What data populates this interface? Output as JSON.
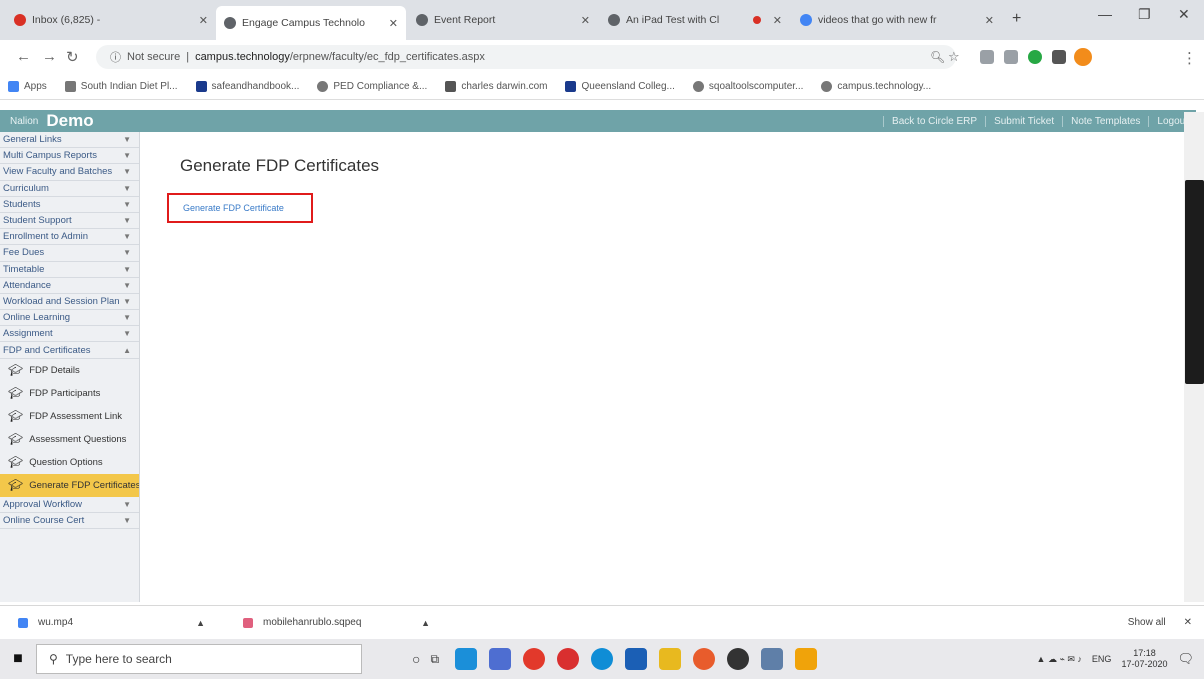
{
  "browser": {
    "tabs": [
      {
        "title": "Inbox (6,825) - ",
        "color": "#d93025"
      },
      {
        "title": "Engage Campus Technolo",
        "color": "#5f6368"
      },
      {
        "title": "Event Report",
        "color": "#5f6368"
      },
      {
        "title": "An iPad Test with Cl",
        "color": "#5f6368"
      },
      {
        "title": "videos that go with new fr",
        "color": "#4285f4"
      }
    ],
    "not_secure": "Not secure",
    "url_domain": "campus.technology",
    "url_path": "/erpnew/faculty/ec_fdp_certificates.aspx"
  },
  "bookmarks": [
    {
      "label": "Apps",
      "color": "#4285f4"
    },
    {
      "label": "South Indian Diet Pl...",
      "color": "#777"
    },
    {
      "label": "safeandhandbook...",
      "color": "#1a3a8c"
    },
    {
      "label": "PED Compliance &...",
      "color": "#777"
    },
    {
      "label": "charles darwin.com",
      "color": "#555"
    },
    {
      "label": "Queensland Colleg...",
      "color": "#1a3a8c"
    },
    {
      "label": "sqoaltoolscomputer...",
      "color": "#777"
    },
    {
      "label": "campus.technology...",
      "color": "#777"
    }
  ],
  "app": {
    "school": "Nalion",
    "brand": "Demo",
    "links": [
      "Back to Circle ERP",
      "Submit Ticket",
      "Note Templates",
      "Logout"
    ]
  },
  "sidebar": {
    "menus": [
      "General Links",
      "Multi Campus Reports",
      "View Faculty and Batches",
      "Curriculum",
      "Students",
      "Student Support",
      "Enrollment to Admin",
      "Fee Dues",
      "Timetable",
      "Attendance",
      "Workload and Session Plan",
      "Online Learning",
      "Assignment",
      "FDP and Certificates"
    ],
    "subitems": [
      {
        "label": "FDP Details",
        "active": false
      },
      {
        "label": "FDP Participants",
        "active": false
      },
      {
        "label": "FDP Assessment Link",
        "active": false
      },
      {
        "label": "Assessment Questions",
        "active": false
      },
      {
        "label": "Question Options",
        "active": false
      },
      {
        "label": "Generate FDP Certificates",
        "active": true
      }
    ],
    "footer_menus": [
      "Approval Workflow",
      "Online Course Cert"
    ]
  },
  "main": {
    "title": "Generate FDP Certificates",
    "link": "Generate FDP Certificate"
  },
  "downloads": [
    {
      "name": "wu.mp4",
      "color": "#4285f4"
    },
    {
      "name": "mobilehanrublo.sqpeq",
      "color": "#e0607e"
    }
  ],
  "show_all": "Show all",
  "taskbar": {
    "search_placeholder": "Type here to search",
    "icons": [
      "#1b8fd9",
      "#4e6ed1",
      "#e2392b",
      "#d92f2f",
      "#0f8dd6",
      "#1b5fb5",
      "#e8b91f",
      "#e85c2c",
      "#333333",
      "#5f7fa8",
      "#f0a30a"
    ],
    "lang": "ENG",
    "time": "17:18",
    "date": "17-07-2020"
  }
}
